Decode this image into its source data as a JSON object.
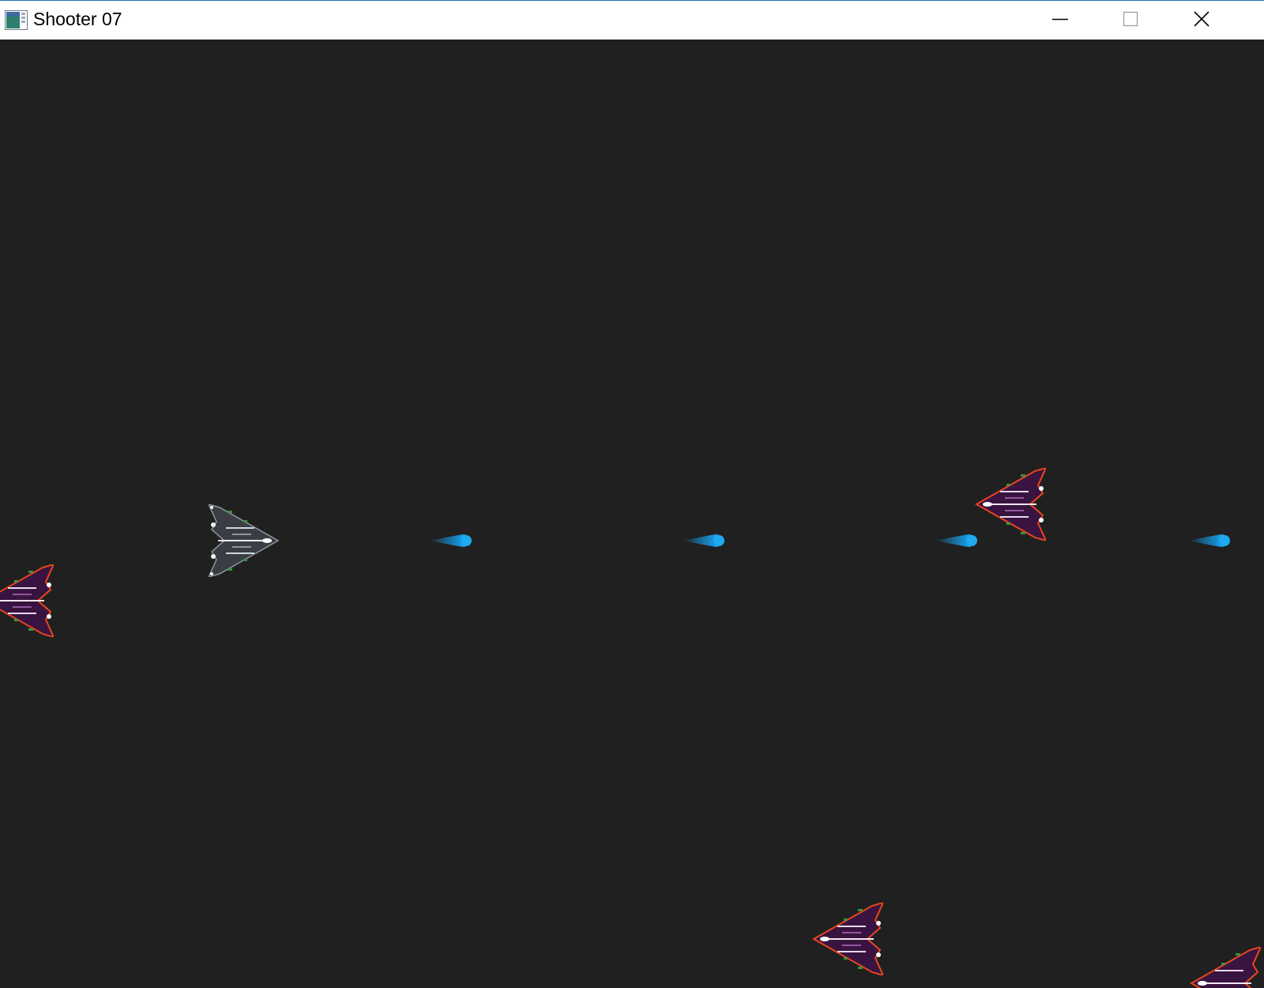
{
  "window": {
    "title": "Shooter 07",
    "icon": "app-window-icon",
    "controls": [
      "minimize-icon",
      "maximize-icon",
      "close-icon"
    ]
  },
  "game": {
    "background_color": "#202020",
    "player": {
      "sprite": "player-ship-icon",
      "color": "#4a4f55"
    },
    "bullets": {
      "count": 4,
      "color": "#1eaaf0"
    },
    "enemies": {
      "count": 4,
      "color": "#e8461e"
    }
  }
}
